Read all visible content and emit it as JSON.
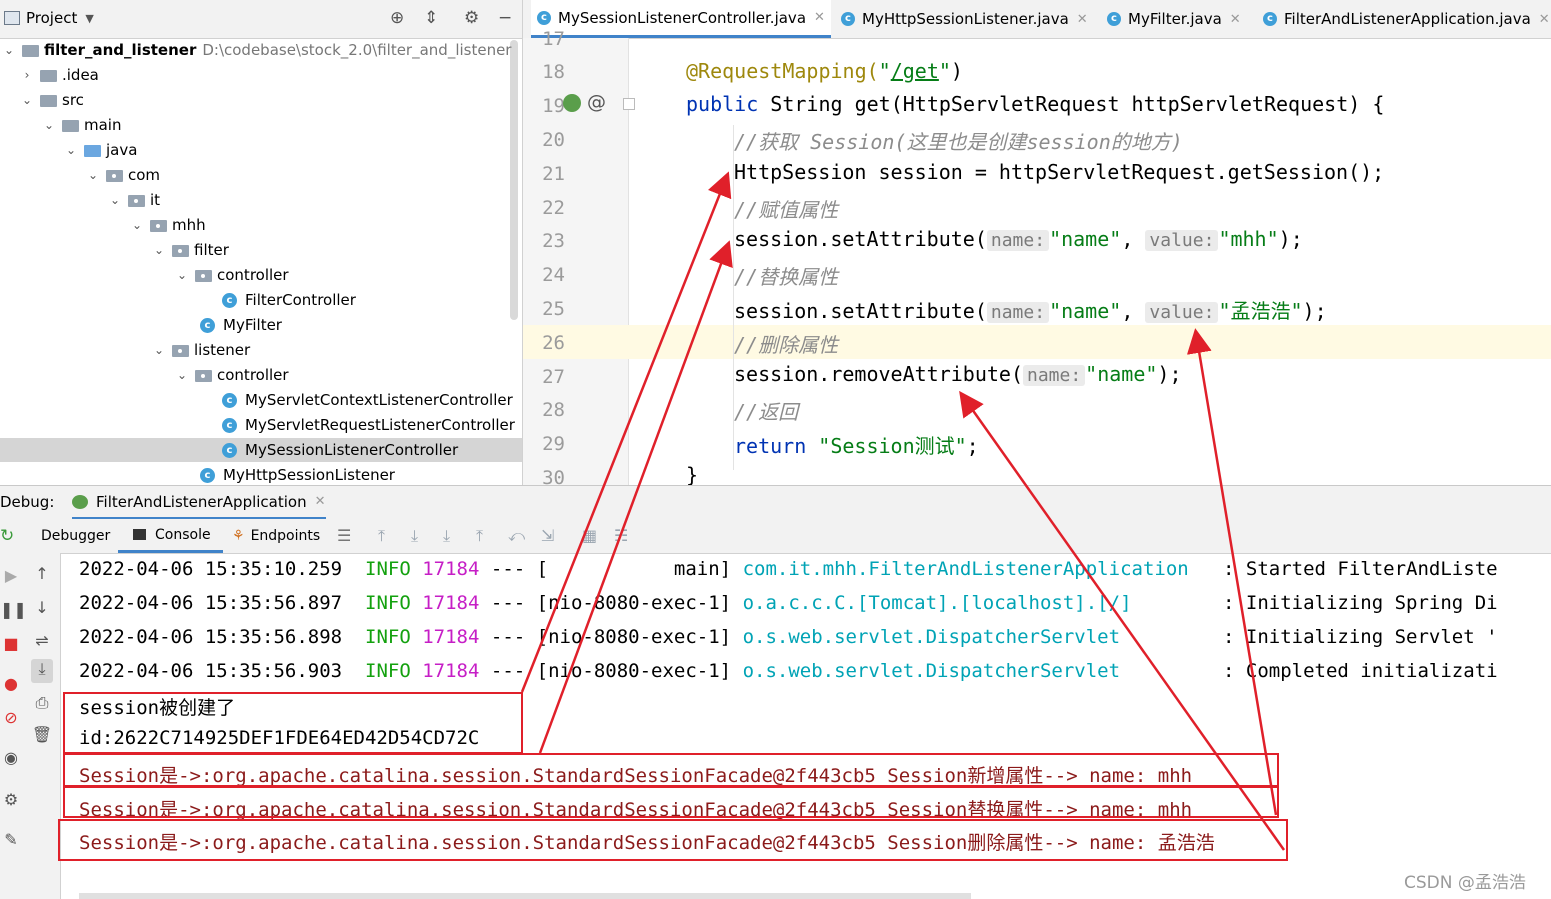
{
  "project": {
    "title": "Project",
    "root_name": "filter_and_listener",
    "root_path": "D:\\codebase\\stock_2.0\\filter_and_listener",
    "tree": [
      {
        "label": ".idea"
      },
      {
        "label": "src"
      },
      {
        "label": "main"
      },
      {
        "label": "java"
      },
      {
        "label": "com"
      },
      {
        "label": "it"
      },
      {
        "label": "mhh"
      },
      {
        "label": "filter"
      },
      {
        "label": "controller"
      },
      {
        "label": "FilterController"
      },
      {
        "label": "MyFilter"
      },
      {
        "label": "listener"
      },
      {
        "label": "controller"
      },
      {
        "label": "MyServletContextListenerController"
      },
      {
        "label": "MyServletRequestListenerController"
      },
      {
        "label": "MySessionListenerController"
      },
      {
        "label": "MyHttpSessionListener"
      }
    ]
  },
  "editor": {
    "tabs": [
      {
        "label": "MySessionListenerController.java"
      },
      {
        "label": "MyHttpSessionListener.java"
      },
      {
        "label": "MyFilter.java"
      },
      {
        "label": "FilterAndListenerApplication.java"
      }
    ],
    "line_numbers": [
      "17",
      "18",
      "19",
      "20",
      "21",
      "22",
      "23",
      "24",
      "25",
      "26",
      "27",
      "28",
      "29",
      "30"
    ],
    "code": {
      "l18_ann": "@RequestMapping(",
      "l18_str_open": "\"",
      "l18_path": "/get",
      "l18_str_close": "\"",
      "l18_end": ")",
      "l19_kw": "public",
      "l19_rest": " String get(HttpServletRequest httpServletRequest) {",
      "l20": "//获取 Session(这里也是创建session的地方)",
      "l21": "HttpSession session = httpServletRequest.getSession();",
      "l22": "//赋值属性",
      "l23_a": "session.setAttribute(",
      "l23_hint1": "name:",
      "l23_s1": "\"name\"",
      "l23_comma": ", ",
      "l23_hint2": "value:",
      "l23_s2": "\"mhh\"",
      "l23_end": ");",
      "l24": "//替换属性",
      "l25_a": "session.setAttribute(",
      "l25_hint1": "name:",
      "l25_s1": "\"name\"",
      "l25_comma": ", ",
      "l25_hint2": "value:",
      "l25_s2": "\"孟浩浩\"",
      "l25_end": ");",
      "l26": "//删除属性",
      "l27_a": "session.removeAttribute(",
      "l27_hint": "name:",
      "l27_s": "\"name\"",
      "l27_end": ");",
      "l28": "//返回",
      "l29_kw": "return",
      "l29_s": " \"Session测试\"",
      "l29_end": ";",
      "l30": "}"
    }
  },
  "debug": {
    "label": "Debug:",
    "config_name": "FilterAndListenerApplication",
    "tabs": {
      "debugger": "Debugger",
      "console": "Console",
      "endpoints": "Endpoints"
    },
    "log_lines": [
      {
        "ts": "2022-04-06 15:35:10.259",
        "level": "INFO",
        "pid": "17184",
        "sep": "---",
        "thread": "[           main]",
        "logger": "com.it.mhh.FilterAndListenerApplication",
        "msg": ": Started FilterAndListe"
      },
      {
        "ts": "2022-04-06 15:35:56.897",
        "level": "INFO",
        "pid": "17184",
        "sep": "---",
        "thread": "[nio-8080-exec-1]",
        "logger": "o.a.c.c.C.[Tomcat].[localhost].[/]",
        "msg": ": Initializing Spring Di"
      },
      {
        "ts": "2022-04-06 15:35:56.898",
        "level": "INFO",
        "pid": "17184",
        "sep": "---",
        "thread": "[nio-8080-exec-1]",
        "logger": "o.s.web.servlet.DispatcherServlet",
        "msg": ": Initializing Servlet '"
      },
      {
        "ts": "2022-04-06 15:35:56.903",
        "level": "INFO",
        "pid": "17184",
        "sep": "---",
        "thread": "[nio-8080-exec-1]",
        "logger": "o.s.web.servlet.DispatcherServlet",
        "msg": ": Completed initializati"
      }
    ],
    "output_lines": [
      "session被创建了",
      "id:2622C714925DEF1FDE64ED42D54CD72C",
      "Session是->:org.apache.catalina.session.StandardSessionFacade@2f443cb5 Session新增属性--> name: mhh",
      "Session是->:org.apache.catalina.session.StandardSessionFacade@2f443cb5 Session替换属性--> name: mhh",
      "Session是->:org.apache.catalina.session.StandardSessionFacade@2f443cb5 Session删除属性--> name: 孟浩浩"
    ]
  },
  "watermark": "CSDN @孟浩浩",
  "colors": {
    "annotation_red": "#e0202a",
    "keyword": "#0033b3",
    "string": "#067d17",
    "annotation": "#9e880d",
    "comment": "#8c8c8c",
    "info_green": "#13a10e",
    "pid_magenta": "#c61ec6",
    "logger_cyan": "#00a3b5",
    "output_dark_red": "#8b1a1a",
    "tab_accent": "#4083c9"
  }
}
